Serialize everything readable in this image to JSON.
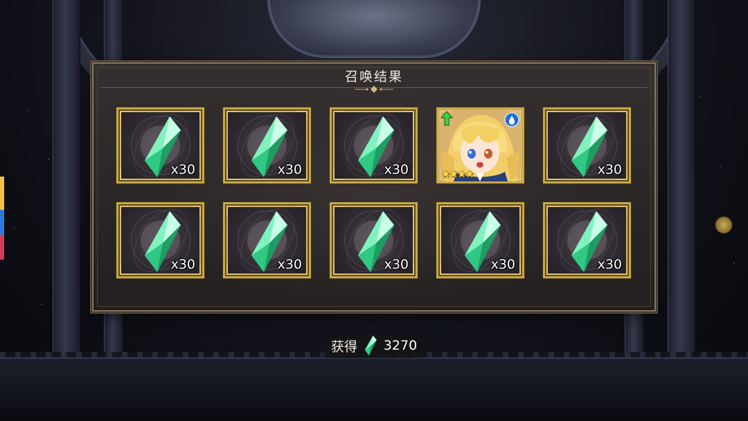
{
  "dialog": {
    "title": "召唤结果"
  },
  "results": [
    {
      "type": "crystal",
      "quantity": "x30"
    },
    {
      "type": "crystal",
      "quantity": "x30"
    },
    {
      "type": "crystal",
      "quantity": "x30"
    },
    {
      "type": "character",
      "rarity_stars": "★★★★",
      "element": "water-icon",
      "badge": "up-arrow-icon"
    },
    {
      "type": "crystal",
      "quantity": "x30"
    },
    {
      "type": "crystal",
      "quantity": "x30"
    },
    {
      "type": "crystal",
      "quantity": "x30"
    },
    {
      "type": "crystal",
      "quantity": "x30"
    },
    {
      "type": "crystal",
      "quantity": "x30"
    },
    {
      "type": "crystal",
      "quantity": "x30"
    }
  ],
  "obtained": {
    "label": "获得",
    "currency_icon": "green-crystal-icon",
    "amount": "3270"
  },
  "colors": {
    "frame_gold": "#c7a94c",
    "crystal_green": "#3fe39a",
    "dialog_bg": "#2a2625"
  }
}
